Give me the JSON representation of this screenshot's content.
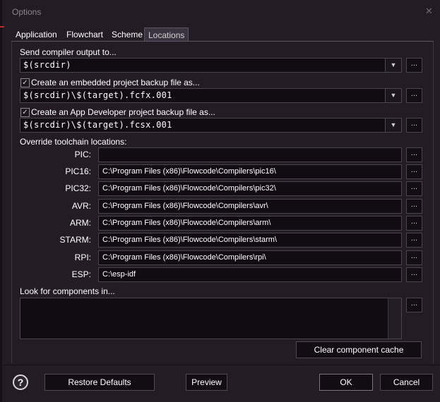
{
  "window": {
    "title": "Options",
    "close_glyph": "✕"
  },
  "tabs": [
    {
      "label": "Application",
      "active": false
    },
    {
      "label": "Flowchart",
      "active": false
    },
    {
      "label": "Scheme",
      "active": false
    },
    {
      "label": "Locations",
      "active": true
    }
  ],
  "compiler_output": {
    "label": "Send compiler output to...",
    "value": "$(srcdir)",
    "browse_label": "..."
  },
  "embedded_backup": {
    "label": "Create an embedded project backup file as...",
    "checked": true,
    "value": "$(srcdir)\\$(target).fcfx.001",
    "browse_label": "..."
  },
  "appdev_backup": {
    "label": "Create an App Developer project backup file as...",
    "checked": true,
    "value": "$(srcdir)\\$(target).fcsx.001",
    "browse_label": "..."
  },
  "toolchain": {
    "heading": "Override toolchain locations:",
    "rows": [
      {
        "label": "PIC:",
        "value": "",
        "browse_label": "..."
      },
      {
        "label": "PIC16:",
        "value": "C:\\Program Files (x86)\\Flowcode\\Compilers\\pic16\\",
        "browse_label": "..."
      },
      {
        "label": "PIC32:",
        "value": "C:\\Program Files (x86)\\Flowcode\\Compilers\\pic32\\",
        "browse_label": "..."
      },
      {
        "label": "AVR:",
        "value": "C:\\Program Files (x86)\\Flowcode\\Compilers\\avr\\",
        "browse_label": "..."
      },
      {
        "label": "ARM:",
        "value": "C:\\Program Files (x86)\\Flowcode\\Compilers\\arm\\",
        "browse_label": "..."
      },
      {
        "label": "STARM:",
        "value": "C:\\Program Files (x86)\\Flowcode\\Compilers\\starm\\",
        "browse_label": "..."
      },
      {
        "label": "RPI:",
        "value": "C:\\Program Files (x86)\\Flowcode\\Compilers\\rpi\\",
        "browse_label": "..."
      },
      {
        "label": "ESP:",
        "value": "C:\\esp-idf",
        "browse_label": "..."
      }
    ]
  },
  "components": {
    "label": "Look for components in...",
    "value": "",
    "browse_label": "...",
    "clear_cache_label": "Clear component cache"
  },
  "footer": {
    "help_glyph": "?",
    "restore_defaults_label": "Restore Defaults",
    "preview_label": "Preview",
    "ok_label": "OK",
    "cancel_label": "Cancel"
  },
  "colors": {
    "background": "#231c25",
    "field": "#100c11",
    "border": "#4a444d",
    "text": "#ffffff"
  }
}
